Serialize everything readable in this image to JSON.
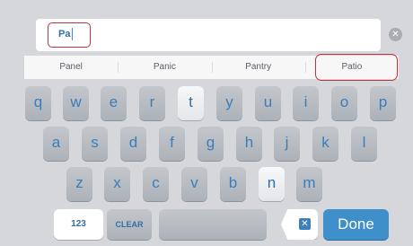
{
  "input": {
    "value": "Pa"
  },
  "clear_icon": "✕",
  "suggestions": [
    "Panel",
    "Panic",
    "Pantry",
    "Patio"
  ],
  "keyboard": {
    "row1": [
      "q",
      "w",
      "e",
      "r",
      "t",
      "y",
      "u",
      "i",
      "o",
      "p"
    ],
    "row2": [
      "a",
      "s",
      "d",
      "f",
      "g",
      "h",
      "j",
      "k",
      "l"
    ],
    "row3": [
      "z",
      "x",
      "c",
      "v",
      "b",
      "n",
      "m"
    ],
    "numbers_label": "123",
    "clear_label": "CLEAR",
    "backspace_icon": "✕",
    "done_label": "Done"
  },
  "colors": {
    "accent": "#3e8fca",
    "highlight_border": "#c8313b"
  }
}
